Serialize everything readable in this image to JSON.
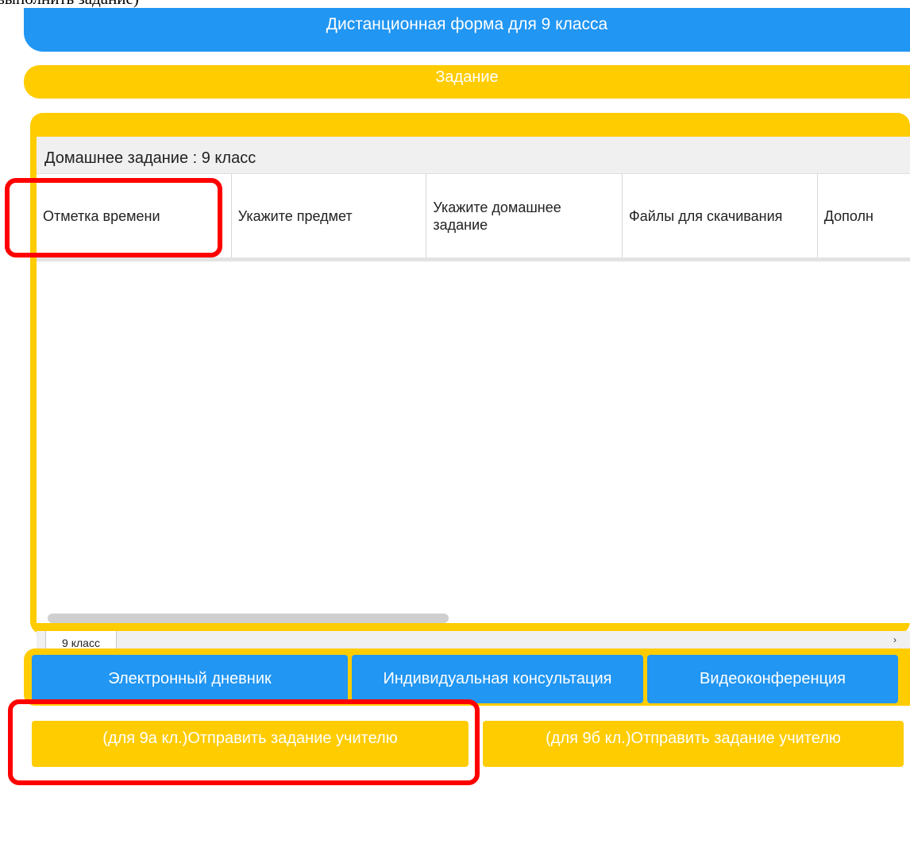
{
  "header": {
    "instruction_text": "выполнить задание)",
    "title": "Дистанционная форма для 9 класса",
    "section_label": "Задание"
  },
  "sheet": {
    "title": "Домашнее задание : 9 класс",
    "columns": [
      "Отметка времени",
      "Укажите предмет",
      "Укажите домашнее задание",
      "Файлы для скачивания",
      "Дополн"
    ],
    "tab_label": "9 класс",
    "tab_arrows": [
      "›",
      "‹"
    ]
  },
  "buttons": {
    "diary": "Электронный дневник",
    "consultation": "Индивидуальная консультация",
    "videoconference": "Видеоконференция",
    "send_9a": "(для 9а кл.)Отправить задание учителю",
    "send_9b": "(для 9б кл.)Отправить задание учителю"
  },
  "colors": {
    "blue": "#2196f3",
    "yellow": "#ffcc00",
    "highlight": "#ff0000"
  }
}
